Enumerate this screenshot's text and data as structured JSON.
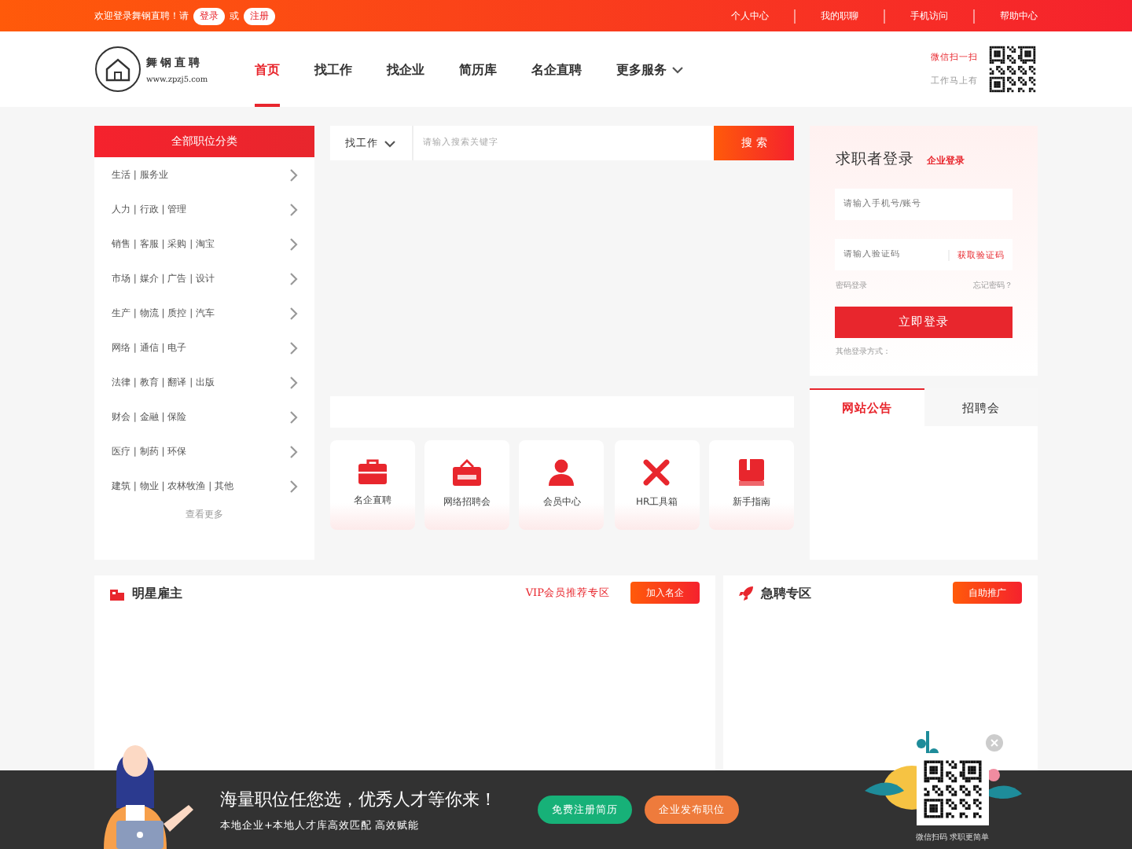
{
  "top_bar": {
    "welcome": "欢迎登录舞钢直聘！请",
    "login": "登录",
    "or": "或",
    "register": "注册",
    "links": [
      "个人中心",
      "我的职聊",
      "手机访问",
      "帮助中心"
    ]
  },
  "header": {
    "logo_title": "舞钢直聘",
    "logo_url": "www.zpzj5.com",
    "nav": [
      {
        "label": "首页",
        "selected": true,
        "dropdown": false
      },
      {
        "label": "找工作",
        "selected": false,
        "dropdown": false
      },
      {
        "label": "找企业",
        "selected": false,
        "dropdown": false
      },
      {
        "label": "简历库",
        "selected": false,
        "dropdown": false
      },
      {
        "label": "名企直聘",
        "selected": false,
        "dropdown": false
      },
      {
        "label": "更多服务",
        "selected": false,
        "dropdown": true
      }
    ],
    "qr_title": "微信扫一扫",
    "qr_subtitle": "工作马上有"
  },
  "categories": {
    "title": "全部职位分类",
    "items": [
      "生活 | 服务业",
      "人力 | 行政 | 管理",
      "销售 | 客服 | 采购 | 淘宝",
      "市场 | 媒介 | 广告 | 设计",
      "生产 | 物流 | 质控 | 汽车",
      "网络 | 通信 | 电子",
      "法律 | 教育 | 翻译 | 出版",
      "财会 | 金融 | 保险",
      "医疗 | 制药 | 环保",
      "建筑 | 物业 | 农林牧渔 | 其他"
    ],
    "more": "查看更多"
  },
  "search": {
    "type": "找工作",
    "placeholder": "请输入搜索关键字",
    "button": "搜 索"
  },
  "quick_links": [
    {
      "kind": "briefcase",
      "label": "名企直聘"
    },
    {
      "kind": "job",
      "label": "网络招聘会"
    },
    {
      "kind": "person",
      "label": "会员中心"
    },
    {
      "kind": "tools",
      "label": "HR工具箱"
    },
    {
      "kind": "book",
      "label": "新手指南"
    }
  ],
  "login": {
    "title": "求职者登录",
    "switch": "企业登录",
    "phone_placeholder": "请输入手机号/账号",
    "code_placeholder": "请输入验证码",
    "get_code": "获取验证码",
    "password_login": "密码登录",
    "forgot": "忘记密码？",
    "submit": "立即登录",
    "other": "其他登录方式："
  },
  "notice_tabs": [
    {
      "label": "网站公告",
      "selected": true
    },
    {
      "label": "招聘会",
      "selected": false
    }
  ],
  "star_employers": {
    "title": "明星雇主",
    "vip": "VIP会员推荐专区",
    "button": "加入名企"
  },
  "urgent": {
    "title": "急聘专区",
    "button": "自助推广"
  },
  "footer_banner": {
    "title": "海量职位任您选，优秀人才等你来！",
    "subtitle": "本地企业+本地人才库高效匹配 高效赋能",
    "buttons": [
      {
        "kind": "green",
        "label": "免费注册简历"
      },
      {
        "kind": "orange",
        "label": "企业发布职位"
      }
    ],
    "qr_caption": "微信扫码 求职更简单"
  }
}
